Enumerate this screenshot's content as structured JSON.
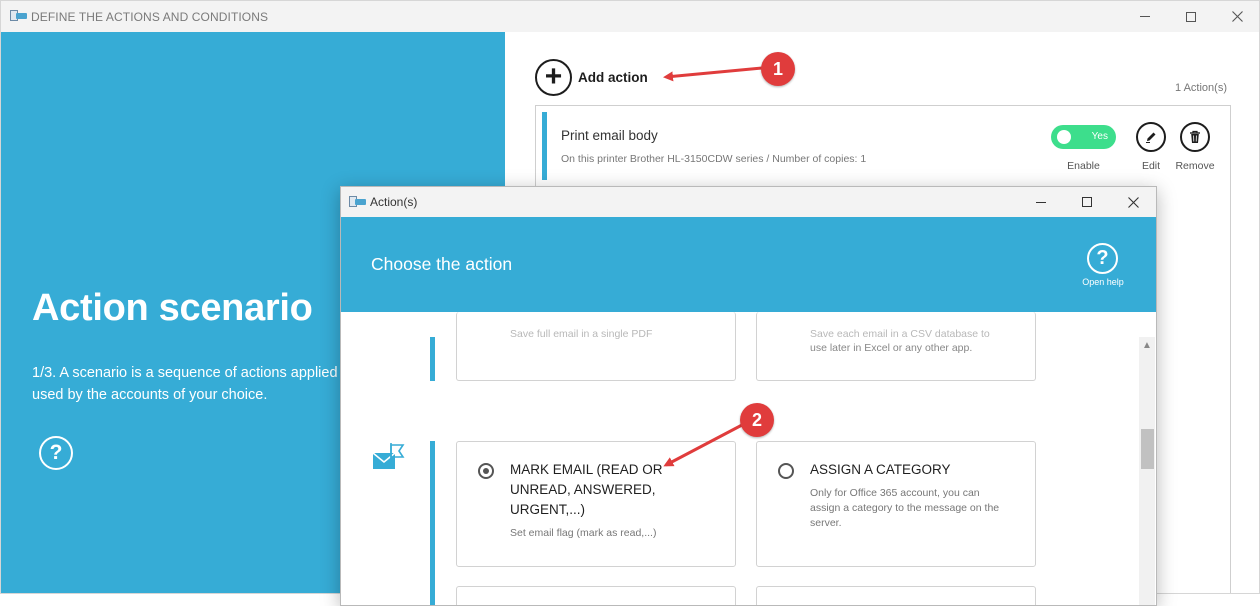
{
  "main_window": {
    "title": "DEFINE THE ACTIONS AND CONDITIONS"
  },
  "left_pane": {
    "title": "Action scenario",
    "description": "1/3. A scenario is a sequence of actions applied to used by the accounts of your choice."
  },
  "right_pane": {
    "add_action_label": "Add action",
    "action_count": "1  Action(s)",
    "actions": [
      {
        "name": "Print email body",
        "details": "On this printer Brother HL-3150CDW series / Number of copies: 1",
        "toggle_text": "Yes",
        "toggle_caption": "Enable",
        "edit_label": "Edit",
        "remove_label": "Remove"
      }
    ]
  },
  "dialog": {
    "title": "Action(s)",
    "heading": "Choose the action",
    "help_label": "Open help",
    "cards": {
      "top_left_faded": "Save full email in a single PDF",
      "top_right_faded": "Save each email in a CSV database to",
      "top_right_desc": "use later in Excel or any other app.",
      "mark_email_title": "MARK EMAIL (READ OR UNREAD, ANSWERED, URGENT,...)",
      "mark_email_desc": "Set email flag (mark as read,...)",
      "assign_category_title": "ASSIGN A CATEGORY",
      "assign_category_desc": "Only for Office 365 account, you can assign a category to the message on the server."
    }
  },
  "annotations": {
    "badge_1": "1",
    "badge_2": "2",
    "color": "#e03c3c"
  },
  "colors": {
    "accent": "#36acd6",
    "toggle_on": "#3dde8c"
  }
}
